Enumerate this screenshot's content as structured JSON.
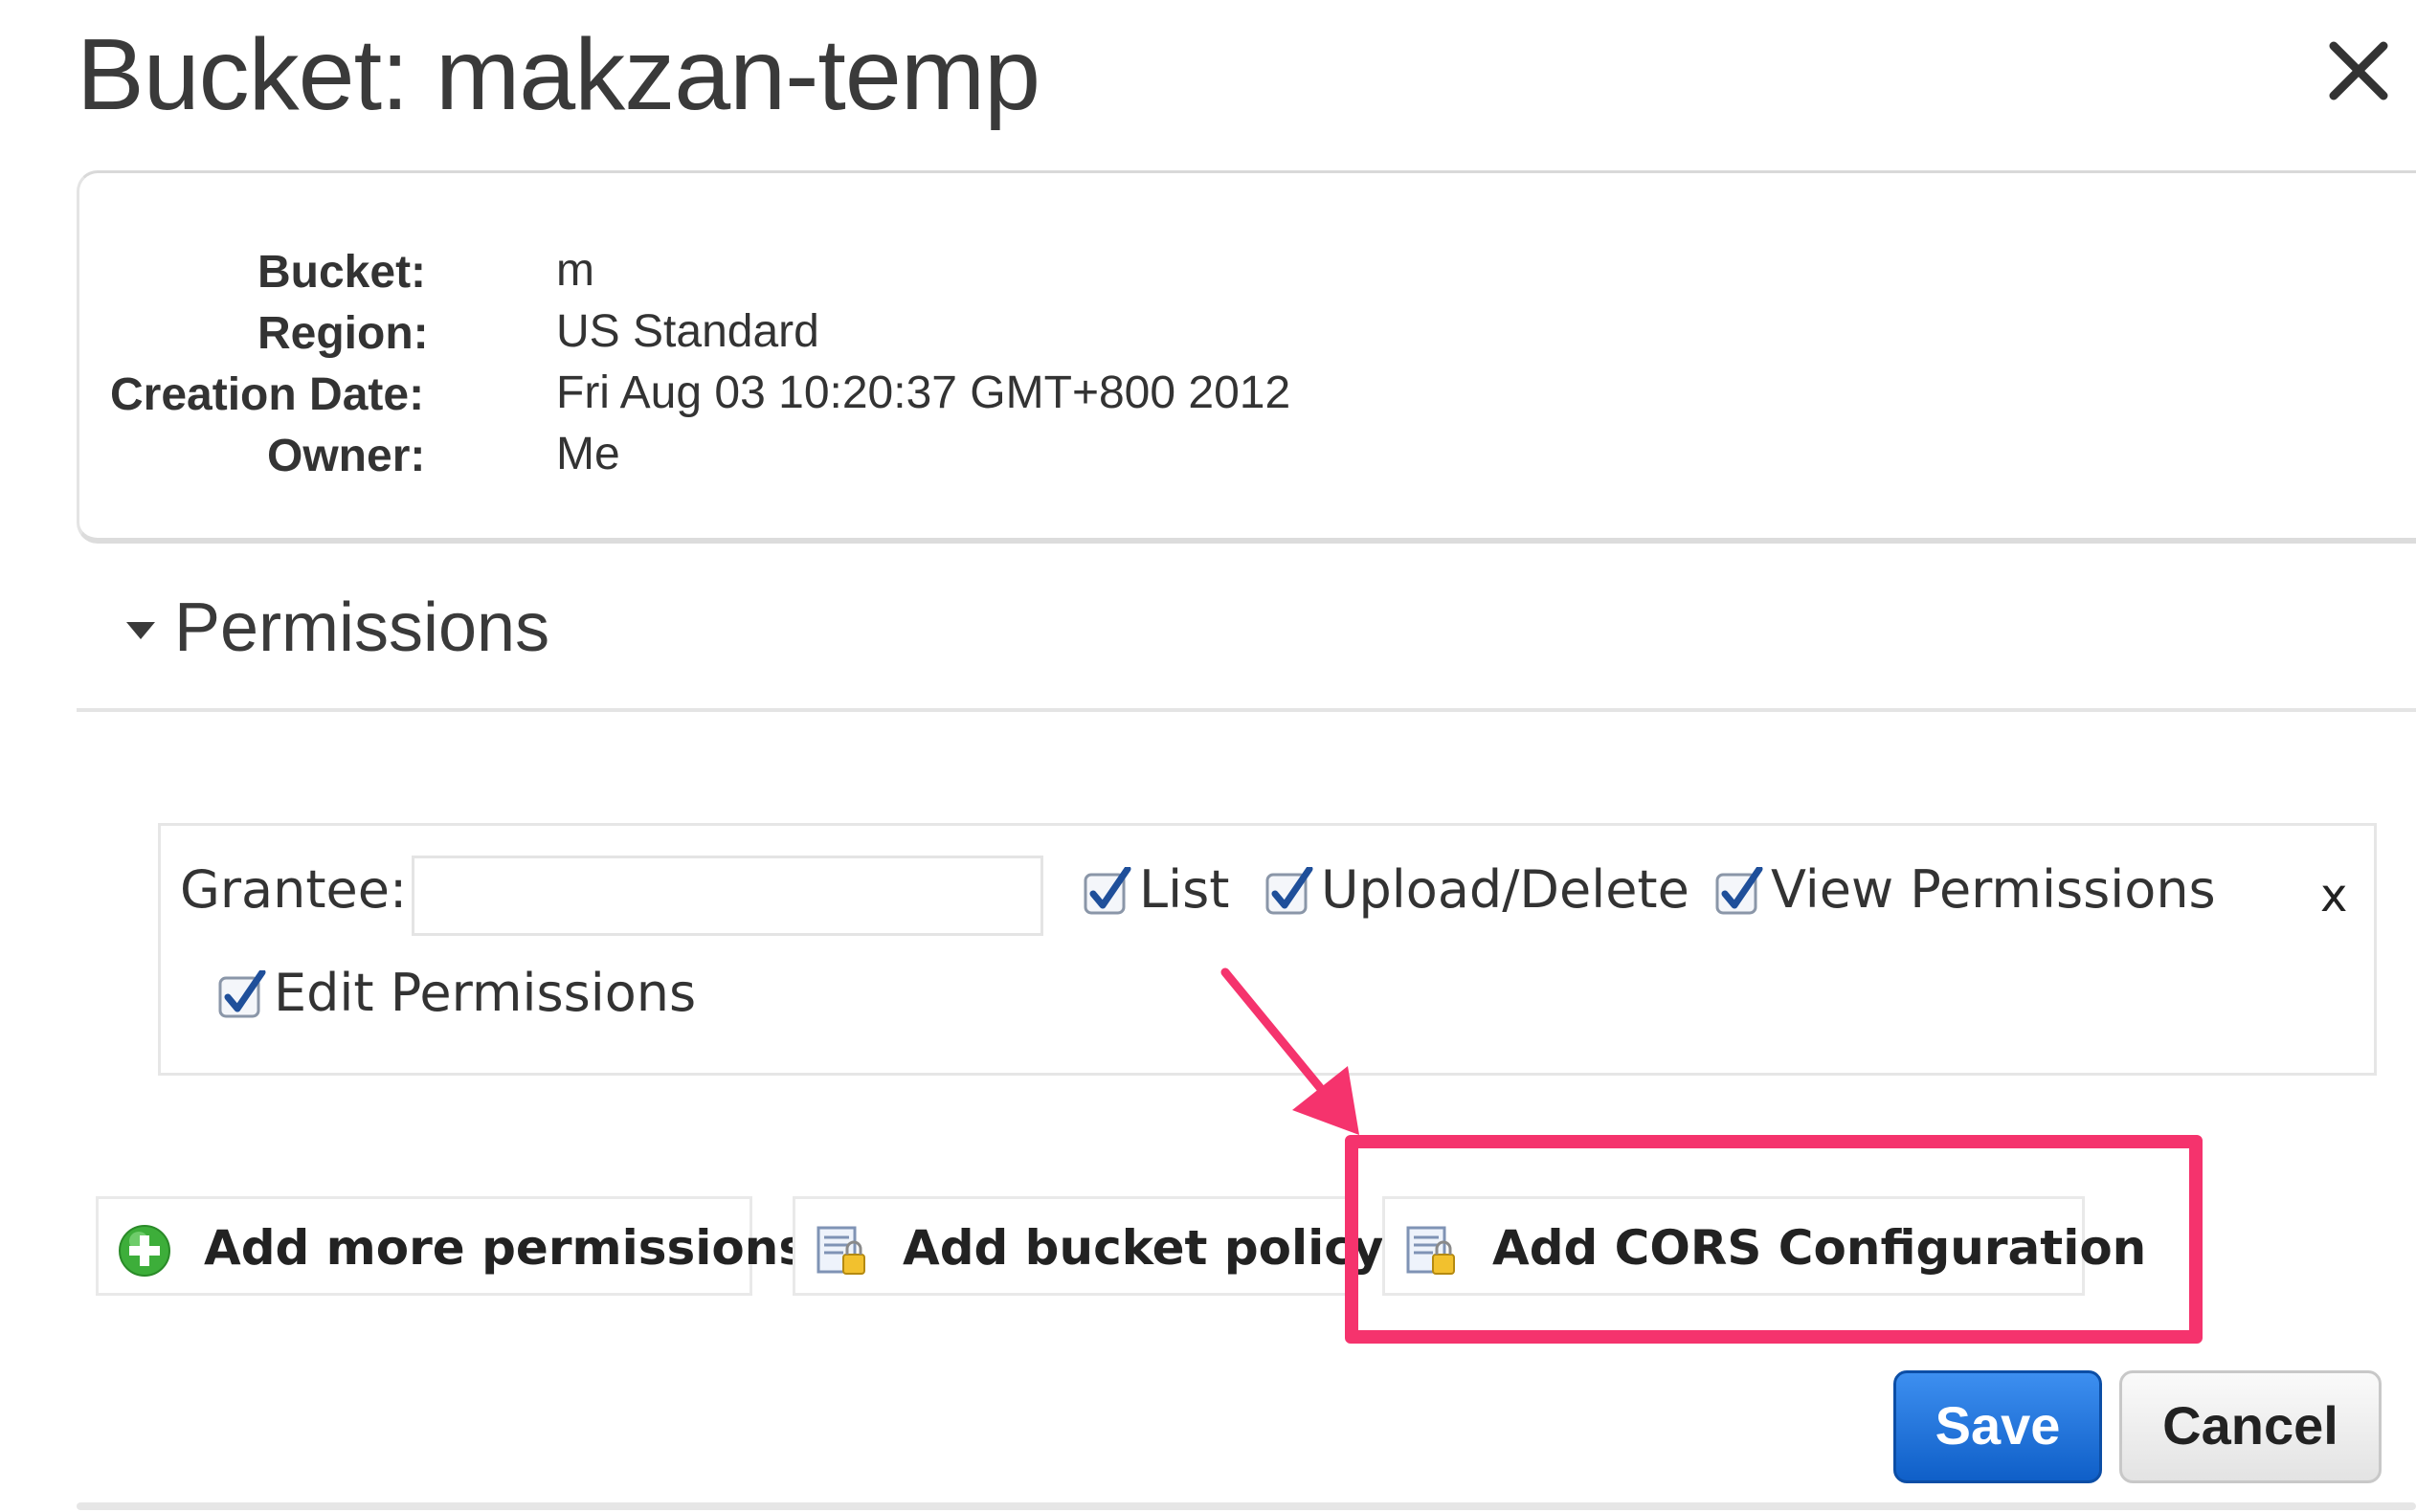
{
  "dialog": {
    "title": "Bucket: makzan-temp",
    "close_glyph": "✕"
  },
  "info": {
    "bucket_label": "Bucket:",
    "bucket_value": "m",
    "region_label": "Region:",
    "region_value": "US Standard",
    "creation_label": "Creation Date:",
    "creation_value": "Fri Aug 03 10:20:37 GMT+800 2012",
    "owner_label": "Owner:",
    "owner_value": "Me"
  },
  "permissions": {
    "section_title": "Permissions",
    "grantee_label": "Grantee:",
    "grantee_value": "",
    "checkboxes": {
      "list": "List",
      "upload_delete": "Upload/Delete",
      "view_permissions": "View Permissions",
      "edit_permissions": "Edit Permissions"
    },
    "checked": {
      "list": true,
      "upload_delete": true,
      "view_permissions": true,
      "edit_permissions": true
    },
    "remove_glyph": "x"
  },
  "actions": {
    "add_more_permissions": "Add more permissions",
    "add_bucket_policy": "Add bucket policy",
    "add_cors_configuration": "Add CORS Configuration"
  },
  "footer": {
    "save_label": "Save",
    "cancel_label": "Cancel"
  },
  "colors": {
    "highlight": "#f5336d",
    "save_button": "#1a6fd6",
    "checkmark": "#1f4f9a"
  }
}
